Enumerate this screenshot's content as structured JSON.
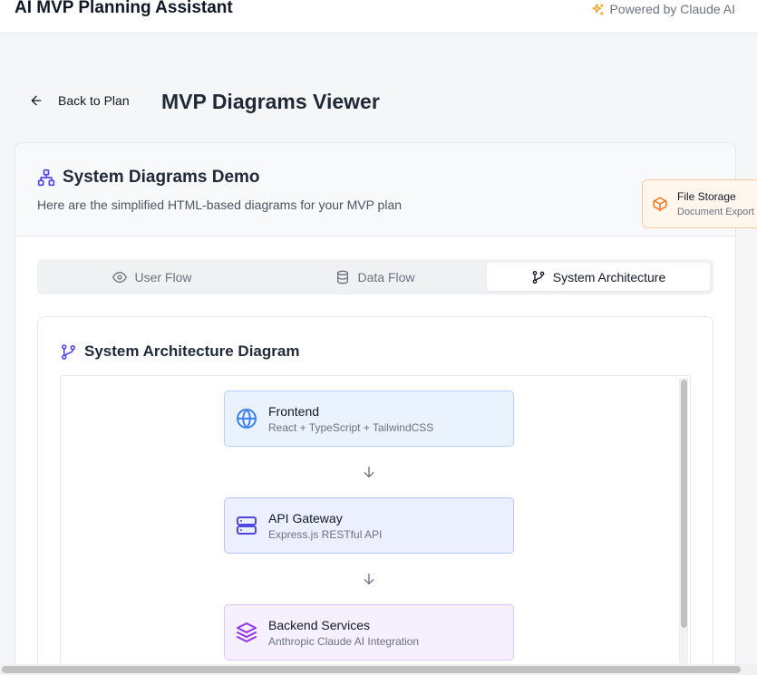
{
  "app": {
    "title": "AI MVP Planning Assistant",
    "powered_by": "Powered by Claude AI"
  },
  "nav": {
    "back_label": "Back to Plan",
    "page_title": "MVP Diagrams Viewer"
  },
  "card": {
    "title": "System Diagrams Demo",
    "subtitle": "Here are the simplified HTML-based diagrams for your MVP plan"
  },
  "tabs": [
    {
      "label": "User Flow",
      "icon": "eye-icon",
      "active": false
    },
    {
      "label": "Data Flow",
      "icon": "database-icon",
      "active": false
    },
    {
      "label": "System Architecture",
      "icon": "git-branch-icon",
      "active": true
    }
  ],
  "diagram": {
    "title": "System Architecture Diagram",
    "nodes": [
      {
        "name": "Frontend",
        "desc": "React + TypeScript + TailwindCSS",
        "icon": "globe-icon",
        "color": "#3b82f6"
      },
      {
        "name": "API Gateway",
        "desc": "Express.js RESTful API",
        "icon": "server-icon",
        "color": "#4f46e5"
      },
      {
        "name": "Backend Services",
        "desc": "Anthropic Claude AI Integration",
        "icon": "layers-icon",
        "color": "#9333ea"
      }
    ]
  },
  "floating_node": {
    "name": "File Storage",
    "desc": "Document Export",
    "icon": "package-icon",
    "color": "#f97316"
  },
  "colors": {
    "accent": "#4f46e5",
    "sparkle": "#f59e0b"
  }
}
